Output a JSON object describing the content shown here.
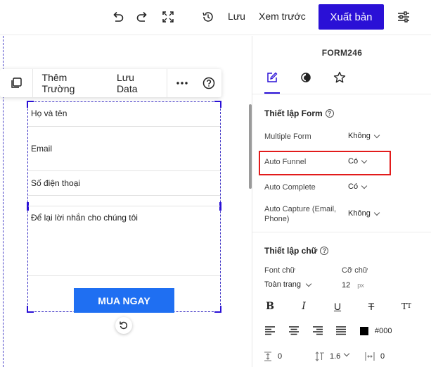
{
  "toolbar": {
    "save_label": "Lưu",
    "preview_label": "Xem trước",
    "publish_label": "Xuất bản"
  },
  "float_toolbar": {
    "add_field_label": "Thêm Trường",
    "save_data_label": "Lưu Data"
  },
  "form": {
    "fields": [
      {
        "placeholder": "Họ và tên"
      },
      {
        "placeholder": "Email"
      },
      {
        "placeholder": "Số điện thoại"
      },
      {
        "placeholder": "Để lại lời nhắn cho chúng tôi"
      }
    ],
    "submit_label": "MUA NGAY"
  },
  "panel": {
    "title": "FORM246",
    "form_settings": {
      "title": "Thiết lập Form",
      "rows": [
        {
          "label": "Multiple Form",
          "value": "Không"
        },
        {
          "label": "Auto Funnel",
          "value": "Có"
        },
        {
          "label": "Auto Complete",
          "value": "Có"
        },
        {
          "label": "Auto Capture (Email, Phone)",
          "value": "Không"
        }
      ]
    },
    "text_settings": {
      "title": "Thiết lập chữ",
      "font_label": "Font chữ",
      "font_value": "Toàn trang",
      "size_label": "Cỡ chữ",
      "size_value": "12",
      "size_unit": "px",
      "color_value": "#000",
      "spacing_value": "0",
      "line_height_value": "1.6",
      "letter_spacing_value": "0"
    }
  },
  "colors": {
    "accent": "#2a10d6",
    "submit": "#1f6ff2",
    "highlight": "#e21b1b"
  }
}
